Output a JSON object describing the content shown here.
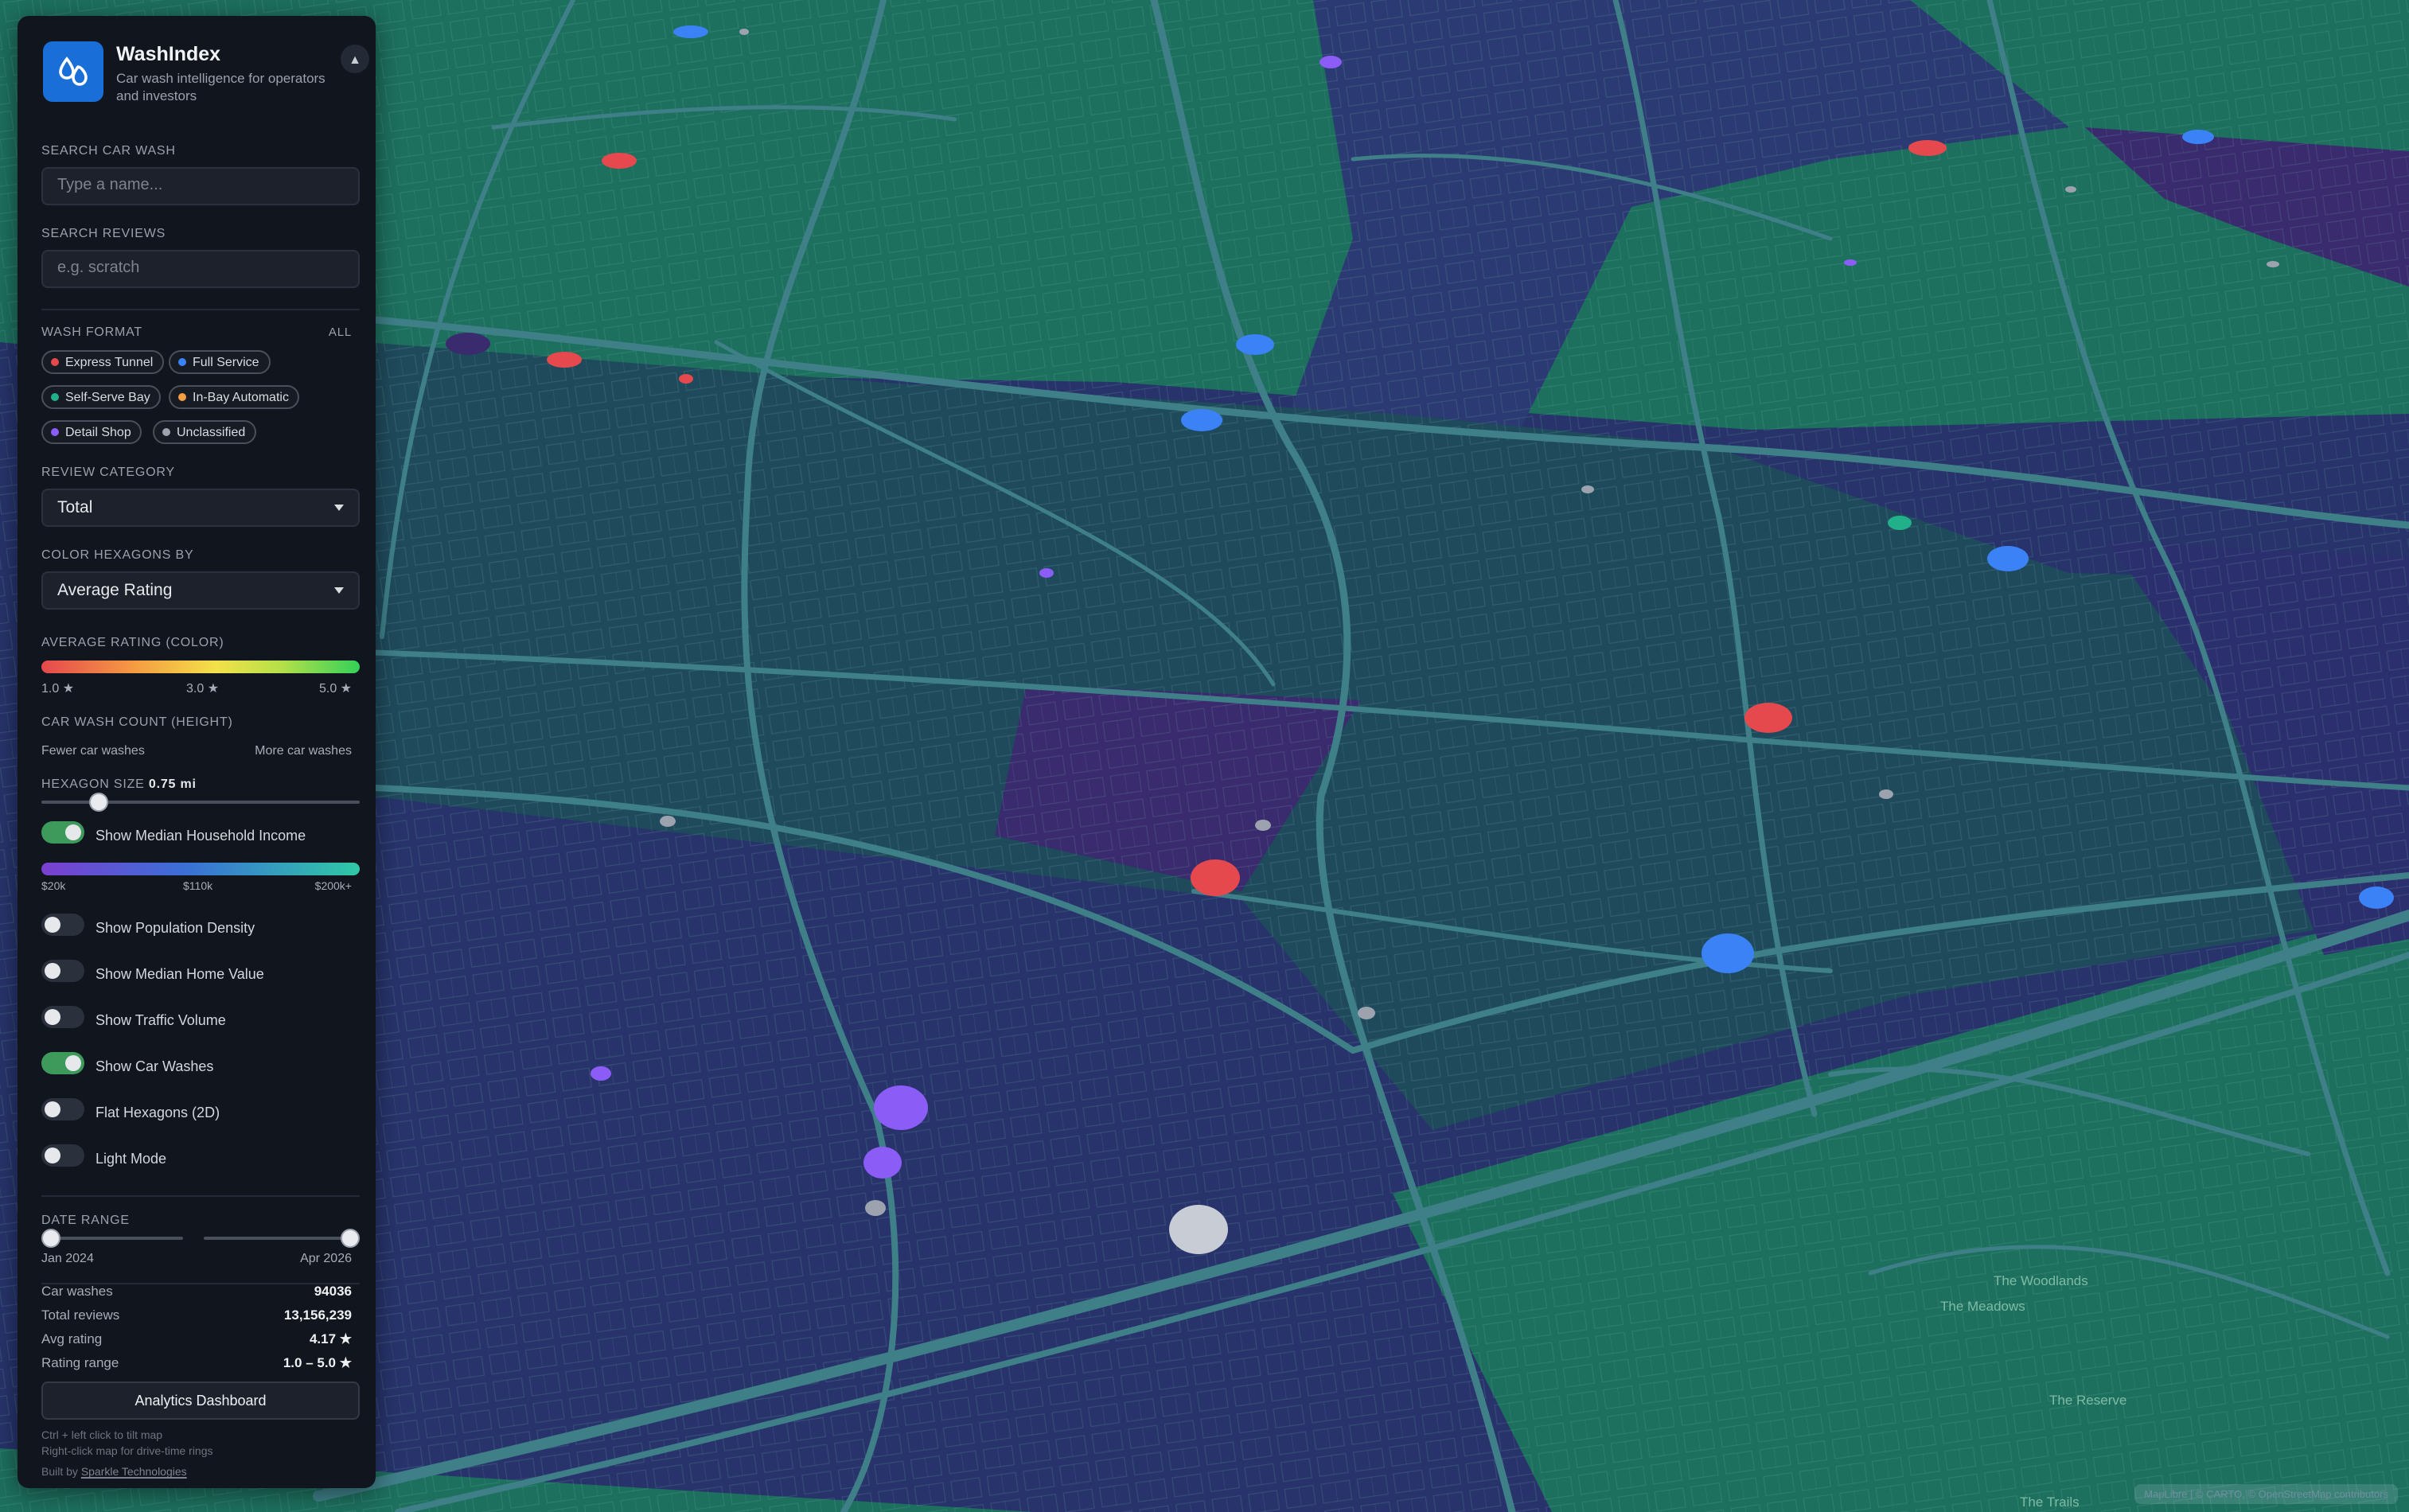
{
  "app": {
    "name": "WashIndex",
    "tagline": "Car wash intelligence for operators and investors",
    "collapse_icon": "▲"
  },
  "search": {
    "car_wash_label": "SEARCH CAR WASH",
    "car_wash_placeholder": "Type a name...",
    "reviews_label": "SEARCH REVIEWS",
    "reviews_placeholder": "e.g. scratch"
  },
  "wash_format": {
    "label": "WASH FORMAT",
    "all_label": "ALL",
    "chips": [
      {
        "label": "Express Tunnel",
        "color": "#e5484d"
      },
      {
        "label": "Full Service",
        "color": "#3b82f6"
      },
      {
        "label": "Self-Serve Bay",
        "color": "#22b08a"
      },
      {
        "label": "In-Bay Automatic",
        "color": "#f59e42"
      },
      {
        "label": "Detail Shop",
        "color": "#8b5cf6"
      },
      {
        "label": "Unclassified",
        "color": "#9ca3af"
      }
    ]
  },
  "review_category": {
    "label": "REVIEW CATEGORY",
    "value": "Total"
  },
  "color_by": {
    "label": "COLOR HEXAGONS BY",
    "value": "Average Rating"
  },
  "rating_legend": {
    "label": "AVERAGE RATING (COLOR)",
    "ticks": [
      "1.0 ★",
      "3.0 ★",
      "5.0 ★"
    ]
  },
  "count_legend": {
    "label": "CAR WASH COUNT (HEIGHT)",
    "low": "Fewer car washes",
    "high": "More car washes"
  },
  "hex_size": {
    "label": "HEXAGON SIZE",
    "value": "0.75 mi",
    "level": 0.18
  },
  "income_legend": {
    "ticks": [
      "$20k",
      "$110k",
      "$200k+"
    ]
  },
  "toggles": {
    "income": {
      "label": "Show Median Household Income",
      "on": true
    },
    "population": {
      "label": "Show Population Density",
      "on": false
    },
    "home_value": {
      "label": "Show Median Home Value",
      "on": false
    },
    "traffic": {
      "label": "Show Traffic Volume",
      "on": false
    },
    "car_washes": {
      "label": "Show Car Washes",
      "on": true
    },
    "flat": {
      "label": "Flat Hexagons (2D)",
      "on": false
    },
    "light": {
      "label": "Light Mode",
      "on": false
    }
  },
  "date_range": {
    "label": "DATE RANGE",
    "start": "Jan 2024",
    "end": "Apr 2026"
  },
  "stats": {
    "car_washes_label": "Car washes",
    "car_washes": "94036",
    "reviews_label": "Total reviews",
    "reviews": "13,156,239",
    "avg_label": "Avg rating",
    "avg": "4.17 ★",
    "range_label": "Rating range",
    "range": "1.0 – 5.0 ★"
  },
  "analytics_button": "Analytics Dashboard",
  "hints": {
    "tilt": "Ctrl + left click to tilt map",
    "rings": "Right-click map for drive-time rings",
    "built_prefix": "Built by ",
    "built_by": "Sparkle Technologies"
  },
  "map": {
    "places": [
      "The Woodlands",
      "The Meadows",
      "The Reserve",
      "The Trails"
    ],
    "attribution": "MapLibre | © CARTO, © OpenStreetMap contributors",
    "colors": {
      "green": "#1d6f5e",
      "teal": "#1f4a5c",
      "navy": "#27336a",
      "purple": "#3a2a6e",
      "road": "#3f7f88"
    }
  }
}
